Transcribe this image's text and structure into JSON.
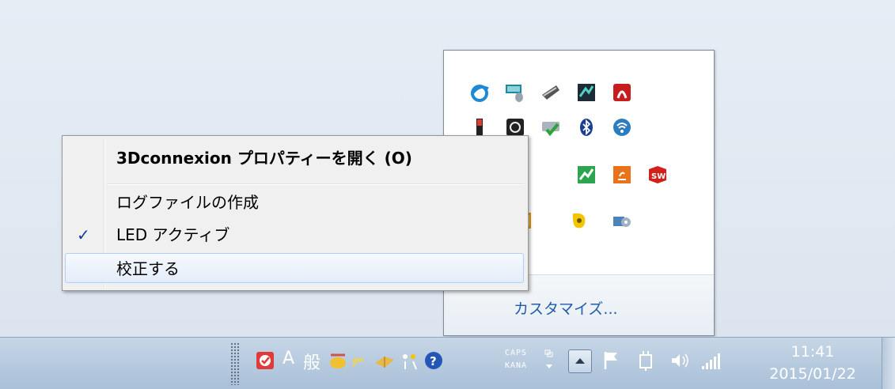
{
  "tray_popup": {
    "customize_label": "カスタマイズ...",
    "icons": [
      "ie-icon",
      "keyboard-mouse-icon",
      "3d-mouse-icon",
      "network-meter-icon",
      "adobe-icon",
      "red-bar-icon",
      "3dconnexion-icon",
      "drive-check-icon",
      "bluetooth-icon",
      "wifi-icon",
      "red-partial-icon",
      "green-chart-icon",
      "java-icon",
      "solidworks-icon",
      "orange-partial-icon",
      "yellow-icon",
      "camera-gear-icon"
    ]
  },
  "context_menu": {
    "items": [
      {
        "label": "3Dconnexion プロパティーを開く (O)",
        "bold": true,
        "checked": false
      },
      {
        "label": "ログファイルの作成",
        "bold": false,
        "checked": false
      },
      {
        "label": "LED アクティブ",
        "bold": false,
        "checked": true
      },
      {
        "label": "校正する",
        "bold": false,
        "checked": false,
        "hover": true
      }
    ],
    "check_mark": "✓"
  },
  "taskbar": {
    "ime_mode": "A",
    "ime_label": "般",
    "caps": "CAPS",
    "kana": "KANA",
    "time": "11:41",
    "date": "2015/01/22"
  },
  "colors": {
    "accent": "#1f5cab",
    "check": "#0c3d99",
    "hover_border": "#aecff7"
  }
}
